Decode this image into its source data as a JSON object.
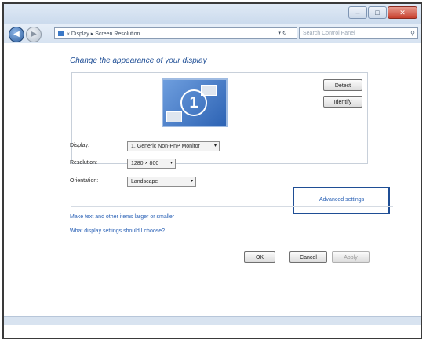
{
  "window": {
    "minimize_glyph": "–",
    "maximize_glyph": "□",
    "close_glyph": "✕"
  },
  "nav": {
    "back_glyph": "◀",
    "forward_glyph": "▶",
    "breadcrumb": "« Display ▸ Screen Resolution",
    "refresh_label": "▾ ↻",
    "search_placeholder": "Search Control Panel",
    "search_icon_glyph": "⚲"
  },
  "main": {
    "heading": "Change the appearance of your display",
    "monitor_number": "1",
    "detect_label": "Detect",
    "identify_label": "Identify",
    "display_label": "Display:",
    "display_value": "1. Generic Non-PnP Monitor",
    "resolution_label": "Resolution:",
    "resolution_value": "1280 × 800",
    "orientation_label": "Orientation:",
    "orientation_value": "Landscape",
    "advanced_settings": "Advanced settings",
    "link_text_larger": "Make text and other items larger or smaller",
    "link_which_settings": "What display settings should I choose?",
    "ok_label": "OK",
    "cancel_label": "Cancel",
    "apply_label": "Apply",
    "caret_glyph": "▾"
  }
}
